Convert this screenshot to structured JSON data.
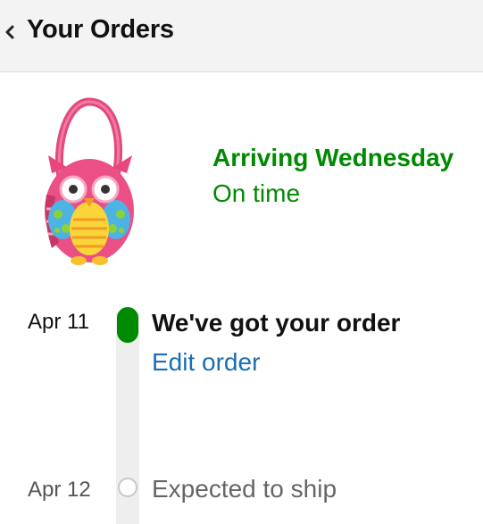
{
  "header": {
    "title": "Your Orders",
    "back_icon": "chevron-left-icon"
  },
  "product": {
    "image": "owl-bag-image"
  },
  "delivery": {
    "title": "Arriving Wednesday",
    "status": "On time",
    "color": "#008a00"
  },
  "timeline": {
    "steps": [
      {
        "date": "Apr 11",
        "title": "We've got your order",
        "action": "Edit order",
        "state": "complete"
      },
      {
        "date": "Apr 12",
        "title": "Expected to ship",
        "state": "pending"
      }
    ],
    "active_color": "#008a00",
    "link_color": "#1a6eb3"
  }
}
